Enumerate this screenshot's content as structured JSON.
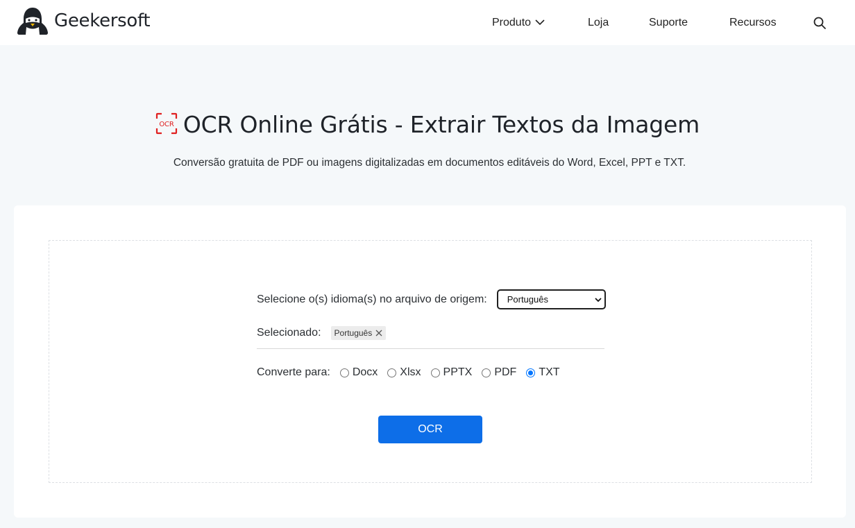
{
  "header": {
    "brand": "Geekersoft",
    "nav": {
      "produto": "Produto",
      "loja": "Loja",
      "suporte": "Suporte",
      "recursos": "Recursos"
    }
  },
  "hero": {
    "icon_text": "OCR",
    "title": "OCR Online Grátis - Extrair Textos da Imagem",
    "subtitle": "Conversão gratuita de PDF ou imagens digitalizadas em documentos editáveis do Word, Excel, PPT e TXT."
  },
  "form": {
    "language_label": "Selecione o(s) idioma(s) no arquivo de origem:",
    "language_selected_value": "Português",
    "selected_label": "Selecionado:",
    "selected_tags": [
      "Português"
    ],
    "convert_label": "Converte para:",
    "formats": [
      {
        "label": "Docx",
        "checked": false
      },
      {
        "label": "Xlsx",
        "checked": false
      },
      {
        "label": "PPTX",
        "checked": false
      },
      {
        "label": "PDF",
        "checked": false
      },
      {
        "label": "TXT",
        "checked": true
      }
    ],
    "submit_label": "OCR"
  },
  "colors": {
    "accent": "#0d6ee8",
    "ocr_icon": "#e02020",
    "background": "#f5f8fa"
  }
}
